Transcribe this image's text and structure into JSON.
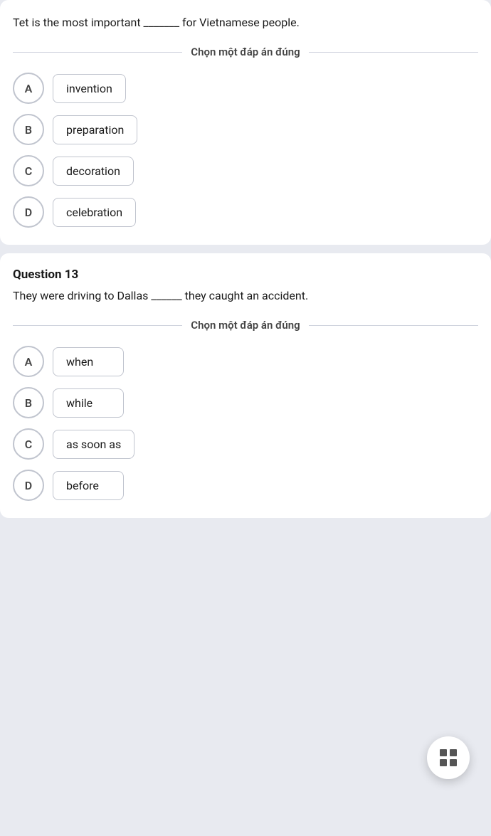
{
  "question12": {
    "title": "",
    "text": "Tet is the most important _______ for Vietnamese people.",
    "divider_label": "Chọn một đáp án đúng",
    "options": [
      {
        "letter": "A",
        "text": "invention"
      },
      {
        "letter": "B",
        "text": "preparation"
      },
      {
        "letter": "C",
        "text": "decoration"
      },
      {
        "letter": "D",
        "text": "celebration"
      }
    ]
  },
  "question13": {
    "title": "Question 13",
    "text": "They were driving to Dallas ______ they caught an accident.",
    "divider_label": "Chọn một đáp án đúng",
    "options": [
      {
        "letter": "A",
        "text": "when"
      },
      {
        "letter": "B",
        "text": "while"
      },
      {
        "letter": "C",
        "text": "as soon as"
      },
      {
        "letter": "D",
        "text": "before"
      }
    ]
  },
  "fab": {
    "aria_label": "Grid menu"
  }
}
